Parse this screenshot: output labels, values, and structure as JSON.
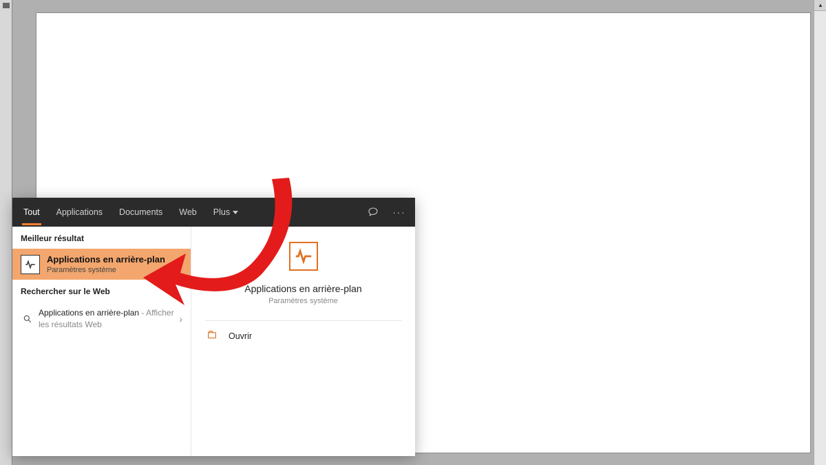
{
  "search": {
    "tabs": [
      "Tout",
      "Applications",
      "Documents",
      "Web",
      "Plus"
    ],
    "bestResultHeader": "Meilleur résultat",
    "bestResult": {
      "title": "Applications en arrière-plan",
      "subtitle": "Paramètres système"
    },
    "webHeader": "Rechercher sur le Web",
    "webResult": {
      "title": "Applications en arrière-plan",
      "suffix": " - Afficher les résultats Web"
    },
    "detail": {
      "title": "Applications en arrière-plan",
      "subtitle": "Paramètres système",
      "open": "Ouvrir"
    }
  },
  "colors": {
    "accent": "#f88030",
    "highlight": "#f3a66e",
    "iconOrange": "#e07020"
  }
}
